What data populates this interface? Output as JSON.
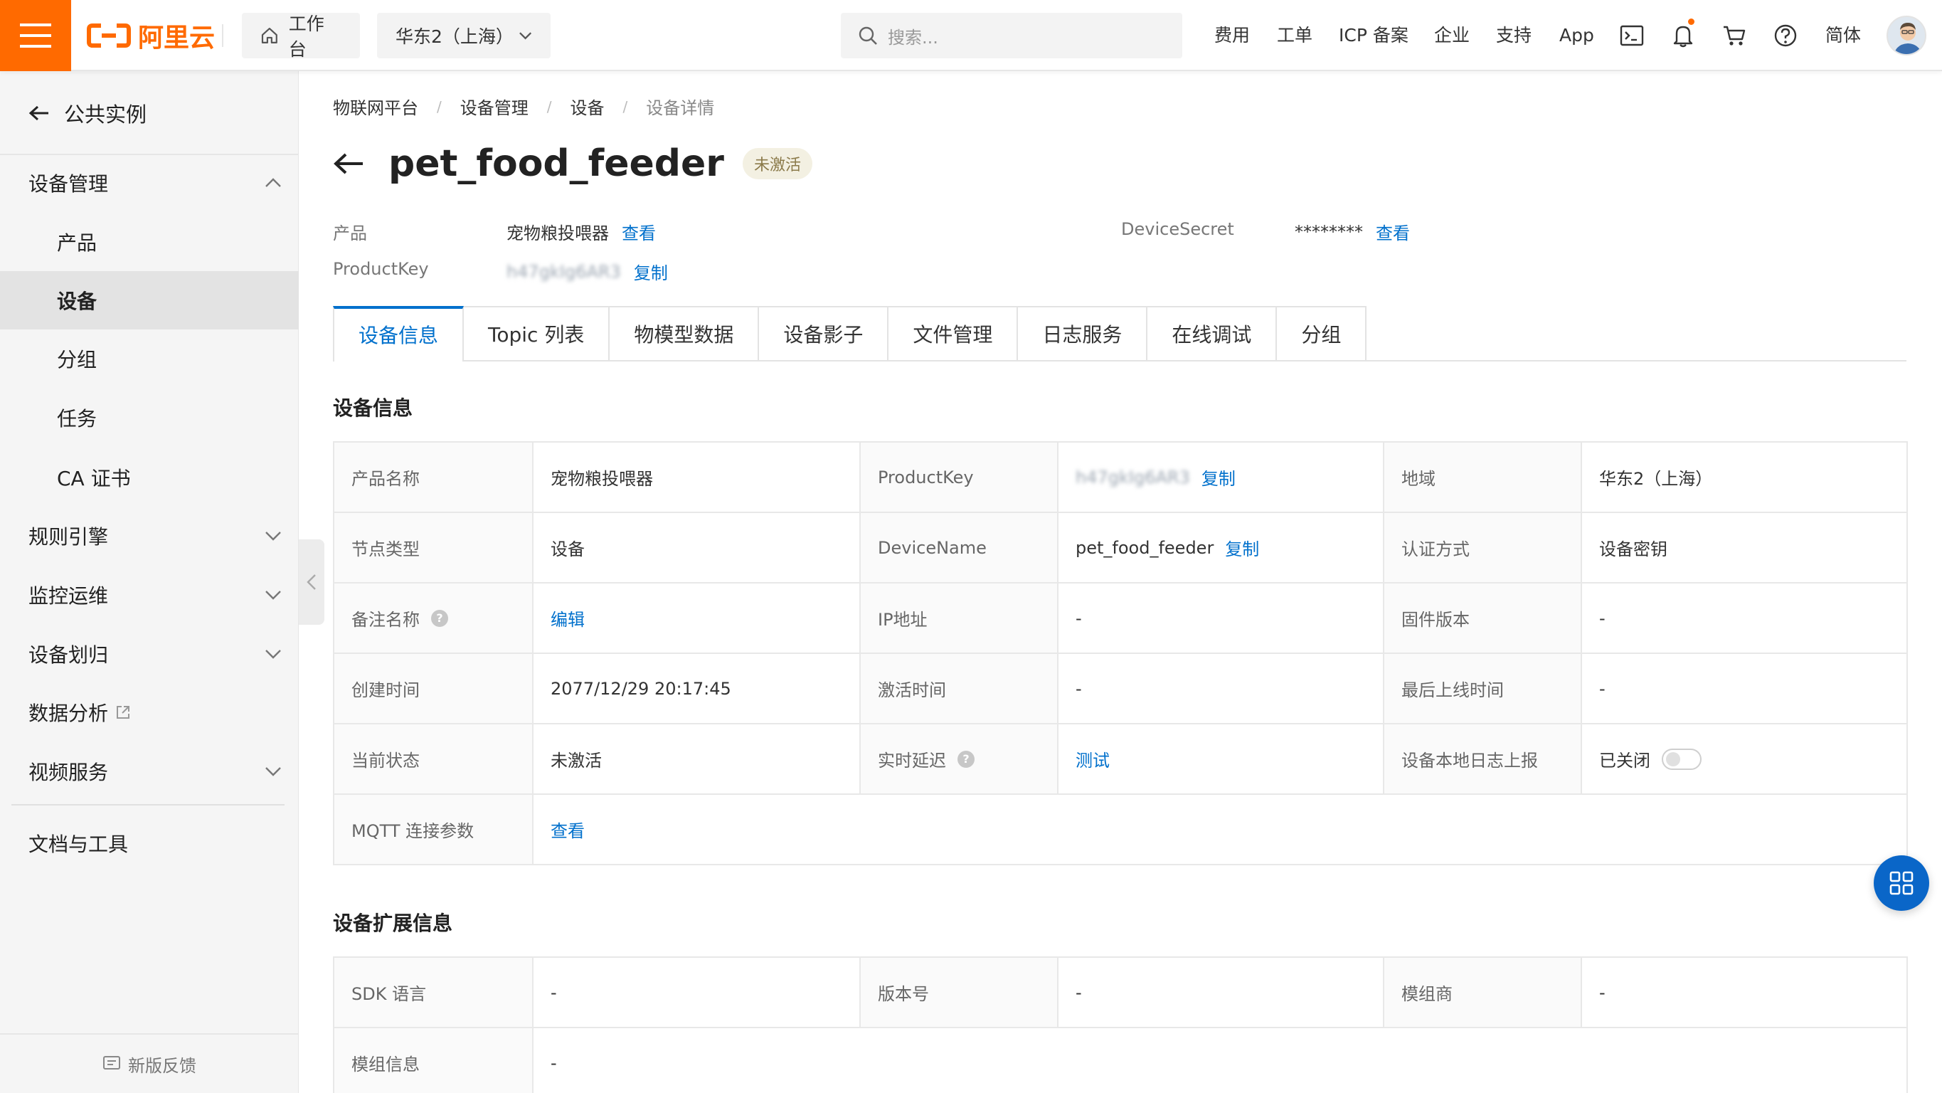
{
  "topbar": {
    "logo_text": "阿里云",
    "workbench_label": "工作台",
    "region_label": "华东2（上海）",
    "search_placeholder": "搜索...",
    "links": [
      "费用",
      "工单",
      "ICP 备案",
      "企业",
      "支持",
      "App"
    ],
    "lang_label": "简体",
    "icons": [
      "terminal-icon",
      "bell-icon",
      "cart-icon",
      "help-icon"
    ],
    "brand_color": "#ff6a00"
  },
  "sidebar": {
    "back_label": "公共实例",
    "group_title": "设备管理",
    "sub_items": [
      "产品",
      "设备",
      "分组",
      "任务",
      "CA 证书"
    ],
    "active_sub": "设备",
    "items": [
      "规则引擎",
      "监控运维",
      "设备划归",
      "数据分析",
      "视频服务"
    ],
    "docs_label": "文档与工具",
    "feedback_label": "新版反馈"
  },
  "breadcrumb": [
    "物联网平台",
    "设备管理",
    "设备",
    "设备详情"
  ],
  "page": {
    "title": "pet_food_feeder",
    "status": "未激活",
    "product_label": "产品",
    "product_value": "宠物粮投喂器",
    "product_view": "查看",
    "productkey_label": "ProductKey",
    "productkey_value": "h47gkIg6AR3",
    "productkey_copy": "复制",
    "secret_label": "DeviceSecret",
    "secret_value": "********",
    "secret_view": "查看"
  },
  "tabs": [
    "设备信息",
    "Topic 列表",
    "物模型数据",
    "设备影子",
    "文件管理",
    "日志服务",
    "在线调试",
    "分组"
  ],
  "active_tab": "设备信息",
  "device_info": {
    "title": "设备信息",
    "product_name_label": "产品名称",
    "product_name": "宠物粮投喂器",
    "productkey_label": "ProductKey",
    "productkey": "h47gkIg6AR3",
    "copy": "复制",
    "region_label": "地域",
    "region": "华东2（上海）",
    "node_type_label": "节点类型",
    "node_type": "设备",
    "devicename_label": "DeviceName",
    "devicename": "pet_food_feeder",
    "auth_label": "认证方式",
    "auth": "设备密钥",
    "alias_label": "备注名称",
    "alias_edit": "编辑",
    "ip_label": "IP地址",
    "ip": "-",
    "firmware_label": "固件版本",
    "firmware": "-",
    "created_label": "创建时间",
    "created": "2077/12/29 20:17:45",
    "activated_label": "激活时间",
    "activated": "-",
    "last_online_label": "最后上线时间",
    "last_online": "-",
    "status_label": "当前状态",
    "status": "未激活",
    "latency_label": "实时延迟",
    "latency_test": "测试",
    "local_log_label": "设备本地日志上报",
    "local_log": "已关闭",
    "mqtt_label": "MQTT 连接参数",
    "mqtt_view": "查看"
  },
  "ext_info": {
    "title": "设备扩展信息",
    "sdk_label": "SDK 语言",
    "sdk": "-",
    "version_label": "版本号",
    "version": "-",
    "vendor_label": "模组商",
    "vendor": "-",
    "module_label": "模组信息",
    "module": "-"
  }
}
